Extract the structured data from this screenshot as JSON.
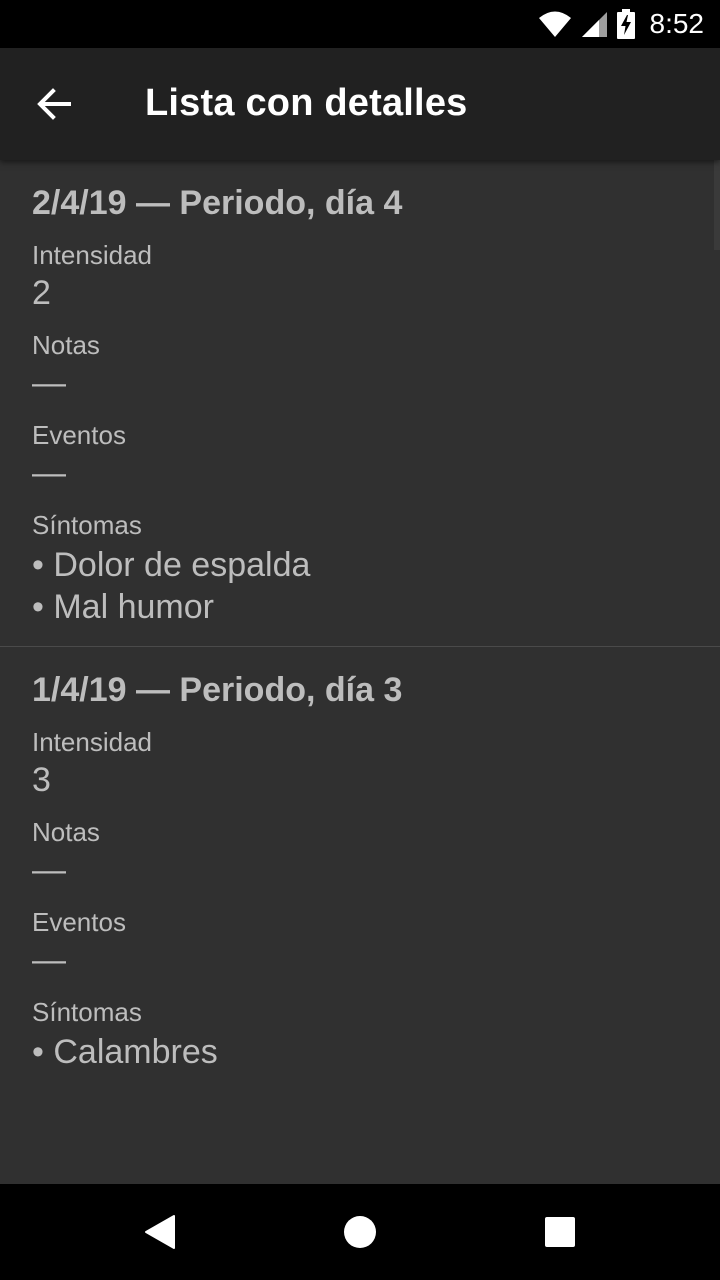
{
  "status_bar": {
    "time": "8:52",
    "icons": [
      "wifi-icon",
      "signal-icon",
      "battery-charging-icon"
    ]
  },
  "app_bar": {
    "back_icon": "arrow-back-icon",
    "title": "Lista con detalles"
  },
  "entries": [
    {
      "title": "2/4/19 — Periodo, día 4",
      "intensity_label": "Intensidad",
      "intensity_value": "2",
      "notes_label": "Notas",
      "notes_value": "—",
      "events_label": "Eventos",
      "events_value": "—",
      "symptoms_label": "Síntomas",
      "symptoms": [
        "• Dolor de espalda",
        "• Mal humor"
      ]
    },
    {
      "title": "1/4/19 — Periodo, día 3",
      "intensity_label": "Intensidad",
      "intensity_value": "3",
      "notes_label": "Notas",
      "notes_value": "—",
      "events_label": "Eventos",
      "events_value": "—",
      "symptoms_label": "Síntomas",
      "symptoms": [
        "• Calambres"
      ]
    }
  ],
  "nav_bar": {
    "buttons": [
      "back-triangle-icon",
      "home-circle-icon",
      "recents-square-icon"
    ]
  },
  "colors": {
    "background": "#303030",
    "app_bar": "#212121",
    "text": "#bdbdbd",
    "title_text": "#ffffff"
  }
}
